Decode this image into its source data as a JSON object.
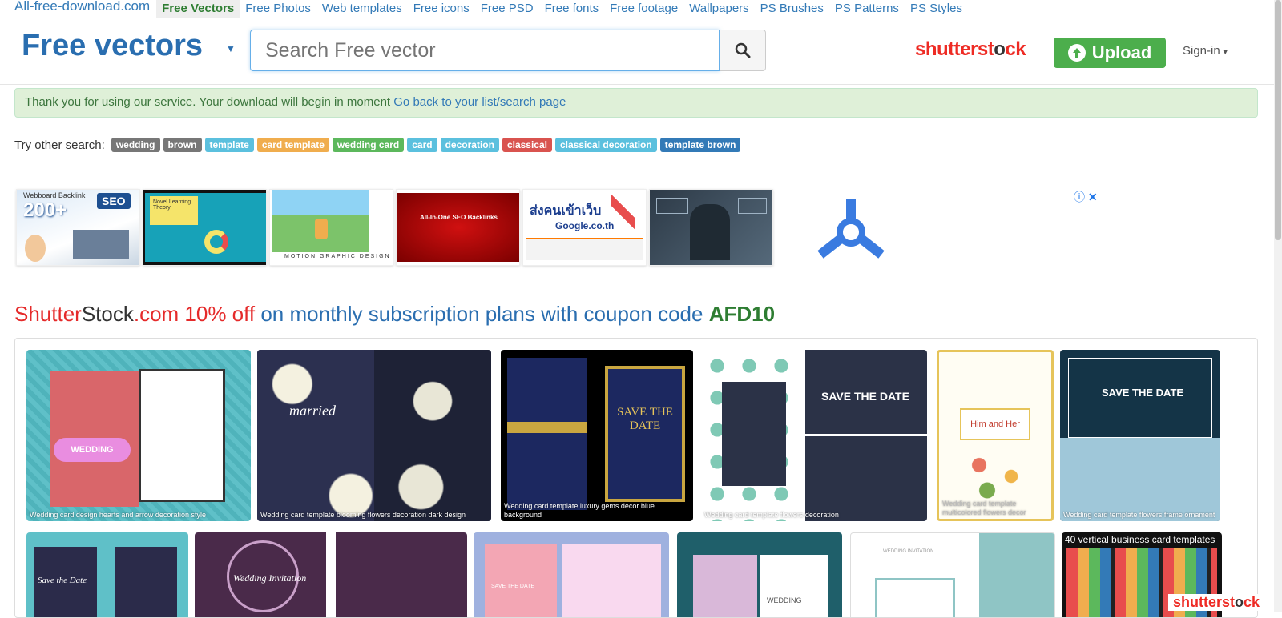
{
  "topnav": {
    "brand": "All-free-download.com",
    "items": [
      {
        "label": "Free Vectors",
        "active": true
      },
      {
        "label": "Free Photos"
      },
      {
        "label": "Web templates"
      },
      {
        "label": "Free icons"
      },
      {
        "label": "Free PSD"
      },
      {
        "label": "Free fonts"
      },
      {
        "label": "Free footage"
      },
      {
        "label": "Wallpapers"
      },
      {
        "label": "PS Brushes"
      },
      {
        "label": "PS Patterns"
      },
      {
        "label": "PS Styles"
      }
    ]
  },
  "header": {
    "title": "Free vectors",
    "search_placeholder": "Search Free vector",
    "shutter_logo_red": "shutterst",
    "shutter_logo_dark": "o",
    "shutter_logo_red2": "ck",
    "upload_label": "Upload",
    "signin_label": "Sign-in"
  },
  "alert": {
    "text": "Thank you for using our service. Your download will begin in moment ",
    "link": "Go back to your list/search page"
  },
  "tags": {
    "label": "Try other search:",
    "items": [
      {
        "label": "wedding",
        "color": "#777777"
      },
      {
        "label": "brown",
        "color": "#777777"
      },
      {
        "label": "template",
        "color": "#5bc0de"
      },
      {
        "label": "card template",
        "color": "#f0ad4e"
      },
      {
        "label": "wedding card",
        "color": "#5cb85c"
      },
      {
        "label": "card",
        "color": "#5bc0de"
      },
      {
        "label": "decoration",
        "color": "#5bc0de"
      },
      {
        "label": "classical",
        "color": "#d9534f"
      },
      {
        "label": "classical decoration",
        "color": "#5bc0de"
      },
      {
        "label": "template brown",
        "color": "#337ab7"
      }
    ]
  },
  "ads": {
    "ad1_text": "Webboard Backlink",
    "ad1_big": "200+",
    "ad1_seo": "SEO",
    "ad2_text": "Novel Learning Theory",
    "ad3_text": "MOTION GRAPHIC DESIGN",
    "ad4_text": "All-In-One SEO Backlinks",
    "ad5_text": "ส่งคนเข้าเว็บ",
    "ad5_sub": "Google.co.th"
  },
  "headline": {
    "part1": "Shutter",
    "part2": "Stock",
    "part3": ".com 10% off",
    "part4": " on monthly subscription plans with coupon code ",
    "code": "AFD10"
  },
  "gallery": {
    "row1": [
      {
        "caption": "Wedding card design hearts and arrow decoration style",
        "text": "WEDDING"
      },
      {
        "caption": "Wedding card template blooming flowers decoration dark design",
        "text": "married"
      },
      {
        "caption": "Wedding card template luxury gems decor blue background",
        "text": "SAVE THE DATE"
      },
      {
        "caption": "Wedding card template flowers decoration",
        "text": "SAVE THE DATE"
      },
      {
        "caption": "Wedding card template multicolored flowers decor",
        "text": "Him and Her"
      },
      {
        "caption": "Wedding card template flowers frame ornament",
        "text": "SAVE THE DATE"
      }
    ],
    "row2": [
      {
        "text": "Save the Date"
      },
      {
        "text": "Wedding Invitation"
      },
      {
        "text": "SAVE THE DATE"
      },
      {
        "text": "WEDDING"
      },
      {
        "text": "WEDDING INVITATION"
      },
      {
        "text": "40 vertical business card templates"
      }
    ]
  },
  "badge": {
    "red": "shutterst",
    "dark": "o",
    "red2": "ck"
  }
}
